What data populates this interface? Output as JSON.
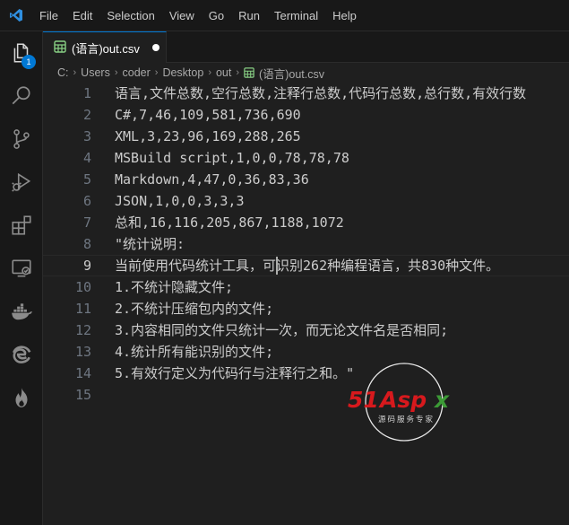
{
  "menu": {
    "items": [
      "File",
      "Edit",
      "Selection",
      "View",
      "Go",
      "Run",
      "Terminal",
      "Help"
    ]
  },
  "activity": {
    "explorer_badge": "1",
    "icons": [
      "files-icon",
      "search-icon",
      "source-control-icon",
      "run-debug-icon",
      "extensions-icon",
      "remote-explorer-icon",
      "docker-icon",
      "edge-icon",
      "fire-icon"
    ]
  },
  "tab": {
    "label": "(语言)out.csv",
    "dirty": true
  },
  "breadcrumb": {
    "parts": [
      "C:",
      "Users",
      "coder",
      "Desktop",
      "out",
      "(语言)out.csv"
    ]
  },
  "editor": {
    "active_line": 9,
    "lines": [
      {
        "n": "1",
        "text": "语言,文件总数,空行总数,注释行总数,代码行总数,总行数,有效行数"
      },
      {
        "n": "2",
        "text": "C#,7,46,109,581,736,690"
      },
      {
        "n": "3",
        "text": "XML,3,23,96,169,288,265"
      },
      {
        "n": "4",
        "text": "MSBuild script,1,0,0,78,78,78"
      },
      {
        "n": "5",
        "text": "Markdown,4,47,0,36,83,36"
      },
      {
        "n": "6",
        "text": "JSON,1,0,0,3,3,3"
      },
      {
        "n": "7",
        "text": "总和,16,116,205,867,1188,1072"
      },
      {
        "n": "8",
        "text": "\"统计说明:"
      },
      {
        "n": "9",
        "text": "当前使用代码统计工具，可识别262种编程语言，共830种文件。"
      },
      {
        "n": "10",
        "text": "1.不统计隐藏文件;"
      },
      {
        "n": "11",
        "text": "2.不统计压缩包内的文件;"
      },
      {
        "n": "12",
        "text": "3.内容相同的文件只统计一次，而无论文件名是否相同;"
      },
      {
        "n": "13",
        "text": "4.统计所有能识别的文件;"
      },
      {
        "n": "14",
        "text": "5.有效行定义为代码行与注释行之和。\""
      },
      {
        "n": "15",
        "text": ""
      }
    ]
  },
  "watermark": {
    "brand": "51Aspx",
    "tagline": "源码服务专家"
  },
  "colors": {
    "accent": "#0078d4",
    "csv_icon": "#89d185",
    "watermark_red": "#d7191d",
    "watermark_green": "#3c9a36"
  }
}
